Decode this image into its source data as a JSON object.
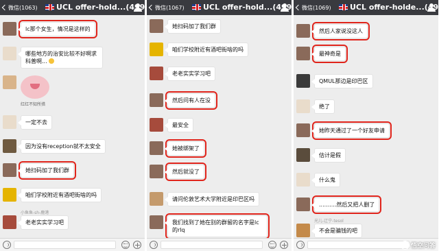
{
  "panels": [
    {
      "back_label": "微信(1063)",
      "title": "UCL offer-hold...(499)",
      "messages": [
        {
          "text": "lc那个女生，情况是这样的",
          "highlight": true,
          "avatar_color": "#8a6a5a"
        },
        {
          "text": "哪些地方的治安比较不好啊求科普啊...",
          "highlight": false,
          "avatar_color": "#e9dccb"
        },
        {
          "sticker_caption": "红红不知所措",
          "avatar_color": "#d9b48a"
        },
        {
          "text": "一定不去",
          "highlight": false,
          "avatar_color": "#e9dccb"
        },
        {
          "text": "因为没有reception就不太安全",
          "highlight": false,
          "avatar_color": "#6f5a40"
        },
        {
          "text": "她扫码加了我们群",
          "highlight": true,
          "avatar_color": "#8a6a5a"
        },
        {
          "text": "咱们学校附近有酒吧街啥的吗",
          "highlight": false,
          "avatar_color": "#e5b400"
        },
        {
          "nick": "小鱼鱼-sh-鹿港",
          "text": "老老实实学习吧",
          "highlight": false,
          "avatar_color": "#a64b3c"
        }
      ]
    },
    {
      "back_label": "微信(1067)",
      "title": "UCL offer-hold...(499)",
      "messages": [
        {
          "text": "她扫码加了我们群",
          "highlight": false,
          "avatar_color": "#8a6a5a"
        },
        {
          "text": "咱们学校附近有酒吧街啥的吗",
          "highlight": false,
          "avatar_color": "#e5b400"
        },
        {
          "text": "老老实实学习吧",
          "highlight": false,
          "avatar_color": "#a64b3c"
        },
        {
          "text": "然后问有人在没",
          "highlight": true,
          "avatar_color": "#8a6a5a"
        },
        {
          "text": "最安全",
          "highlight": false,
          "avatar_color": "#a64b3c"
        },
        {
          "text": "她被绑架了",
          "highlight": true,
          "avatar_color": "#8a6a5a"
        },
        {
          "text": "然后就没了",
          "highlight": true,
          "avatar_color": "#8a6a5a"
        },
        {
          "text": "请问伦敦艺术大学附近是印巴区吗",
          "highlight": false,
          "avatar_color": "#c49a6c"
        },
        {
          "text": "我们找到了她在别的群留的名字是lc的rlq",
          "highlight": true,
          "avatar_color": "#8a6a5a"
        }
      ]
    },
    {
      "back_label": "微信(1069)",
      "title": "UCL offer-holde...(499)",
      "messages": [
        {
          "text": "然后人家说没这人",
          "highlight": true,
          "avatar_color": "#8a6a5a"
        },
        {
          "text": "最神奇是",
          "highlight": true,
          "avatar_color": "#8a6a5a"
        },
        {
          "text": "QMUL那边是印巴区",
          "highlight": false,
          "avatar_color": "#3a3a3a"
        },
        {
          "text": "绝了",
          "highlight": false,
          "avatar_color": "#e9dccb"
        },
        {
          "text": "她昨天通过了一个好友申请",
          "highlight": true,
          "avatar_color": "#8a6a5a"
        },
        {
          "text": "估计是假",
          "highlight": false,
          "avatar_color": "#5a4c3c"
        },
        {
          "text": "什么鬼",
          "highlight": false,
          "avatar_color": "#e9dccb"
        },
        {
          "text": "..........然后又把人删了",
          "highlight": true,
          "avatar_color": "#8a6a5a"
        },
        {
          "nick": "光儿-辽宁-tesol",
          "text": "不会是骗钱的吧",
          "highlight": false,
          "avatar_color": "#c48a4a"
        }
      ]
    }
  ],
  "watermark": "悟空问答"
}
